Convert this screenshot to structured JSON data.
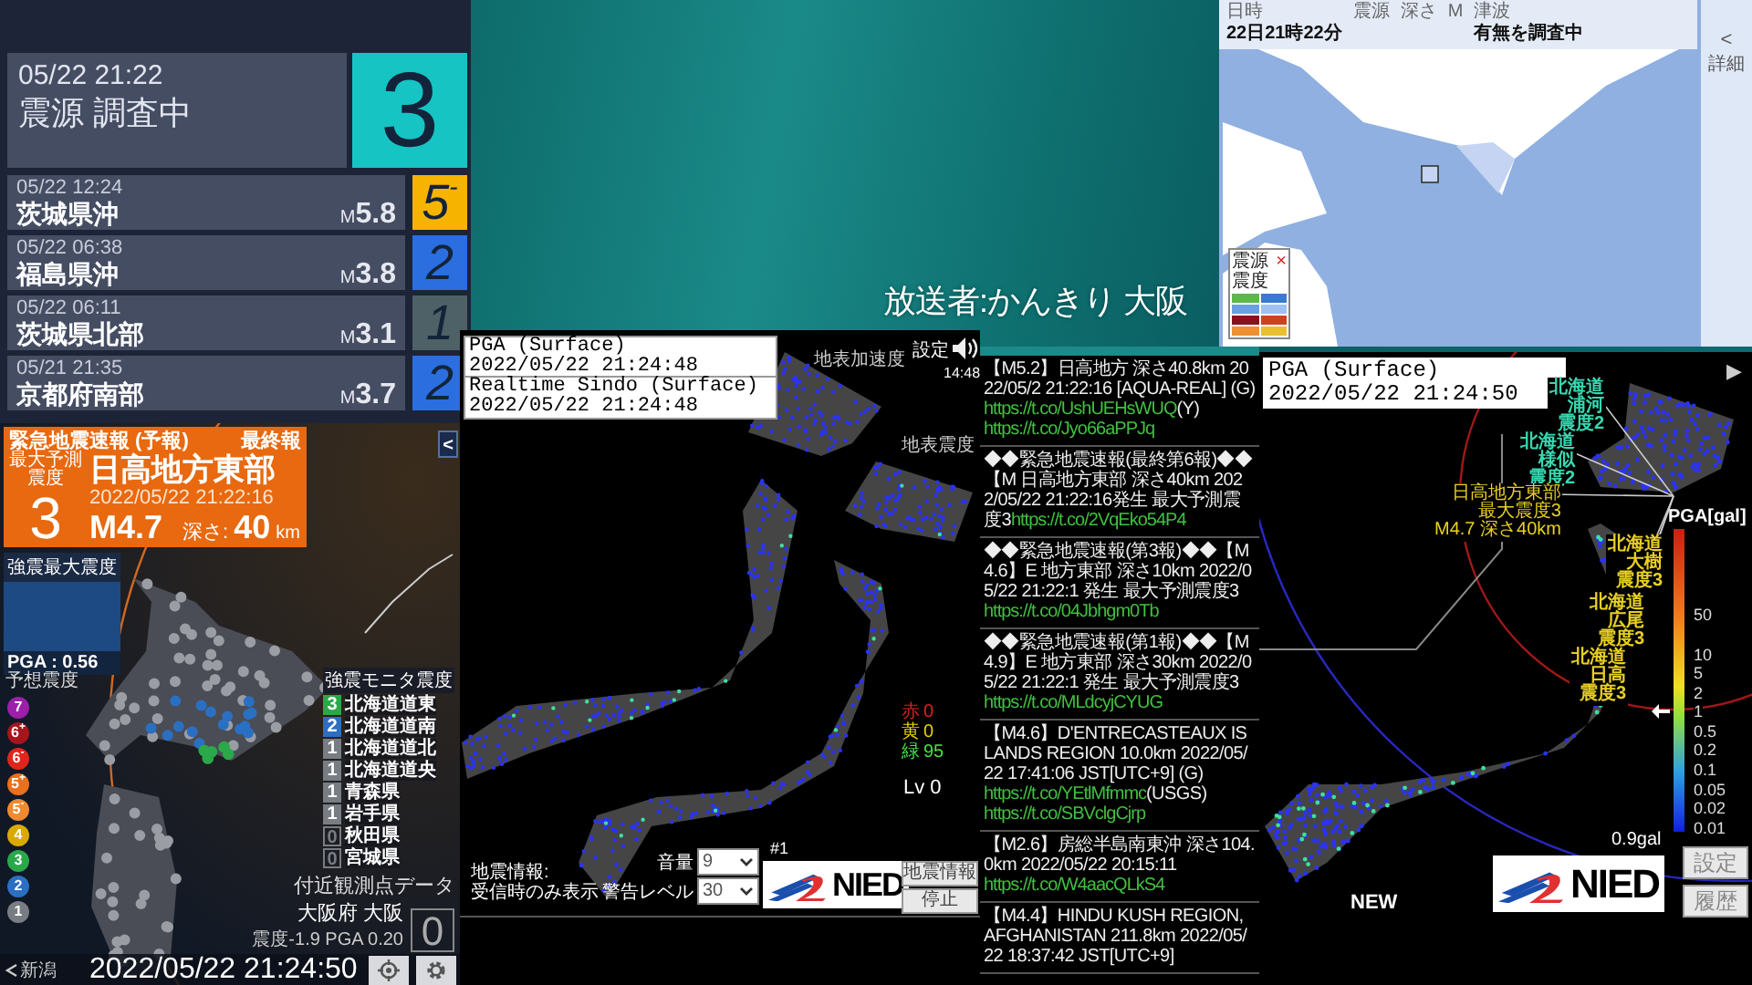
{
  "history": {
    "latest": {
      "time": "05/22  21:22",
      "place": "震源  調査中",
      "intensity": "3",
      "color": "#16c4c4"
    },
    "items": [
      {
        "time": "05/22 12:24",
        "place": "茨城県沖",
        "m_unit": "M",
        "magnitude": "5.8",
        "intensity": "5$^{-}$",
        "color": "#f6b400"
      },
      {
        "time": "05/22 06:38",
        "place": "福島県沖",
        "m_unit": "M",
        "magnitude": "3.8",
        "intensity": "2",
        "color": "#2a6ee0"
      },
      {
        "time": "05/22 06:11",
        "place": "茨城県北部",
        "m_unit": "M",
        "magnitude": "3.1",
        "intensity": "1",
        "color": "#4d6166"
      },
      {
        "time": "05/21 21:35",
        "place": "京都府南部",
        "m_unit": "M",
        "magnitude": "3.7",
        "intensity": "2",
        "color": "#2a6ee0"
      }
    ]
  },
  "eew": {
    "title": "緊急地震速報 (予報)",
    "report": "最終報",
    "max_label": "最大予測震度",
    "intensity": "3",
    "region": "日高地方東部",
    "time": "2022/05/22 21:22:16",
    "magnitude": "M4.7",
    "depth_label": "深さ:",
    "depth": "40",
    "depth_unit": "km",
    "collapse": "<",
    "strong_motion": {
      "label": "強震最大震度",
      "pga": "PGA : 0.56"
    },
    "forecast_legend": {
      "title": "予想震度",
      "levels": [
        {
          "label": "7",
          "color": "#9b1fa8"
        },
        {
          "label": "6$^{+}$",
          "color": "#a8141c"
        },
        {
          "label": "6$^{-}$",
          "color": "#e0261c"
        },
        {
          "label": "5$^{+}$",
          "color": "#e8701e"
        },
        {
          "label": "5$^{-}$",
          "color": "#f08a30"
        },
        {
          "label": "4",
          "color": "#d9aa00"
        },
        {
          "label": "3",
          "color": "#2aa84a"
        },
        {
          "label": "2",
          "color": "#2b6fc2"
        },
        {
          "label": "1",
          "color": "#787d84"
        }
      ]
    },
    "monitor": {
      "title": "強震モニタ震度",
      "stations": [
        {
          "intensity": "3",
          "name": "北海道道東",
          "kind": "filled",
          "color": "#2aa84a"
        },
        {
          "intensity": "2",
          "name": "北海道道南",
          "kind": "filled",
          "color": "#2b6fc2"
        },
        {
          "intensity": "1",
          "name": "北海道道北",
          "kind": "filled",
          "color": "#787d84"
        },
        {
          "intensity": "1",
          "name": "北海道道央",
          "kind": "filled",
          "color": "#787d84"
        },
        {
          "intensity": "1",
          "name": "青森県",
          "kind": "filled",
          "color": "#787d84"
        },
        {
          "intensity": "1",
          "name": "岩手県",
          "kind": "filled",
          "color": "#787d84"
        },
        {
          "intensity": "0",
          "name": "秋田県",
          "kind": "outline",
          "color": "#787d84"
        },
        {
          "intensity": "0",
          "name": "宮城県",
          "kind": "outline",
          "color": "#787d84"
        }
      ]
    },
    "nearby": {
      "title": "付近観測点データ",
      "station": "大阪府 大阪",
      "reading": "震度-1.9  PGA 0.20",
      "intensity": "0"
    },
    "footer": {
      "back": "新潟",
      "clock": "2022/05/22 21:24:50"
    }
  },
  "realtime": {
    "boxes": [
      {
        "title": "PGA (Surface)",
        "time": "2022/05/22 21:24:48"
      },
      {
        "title": "Realtime Sindo (Surface)",
        "time": "2022/05/22 21:24:48"
      }
    ],
    "map_labels": [
      "地表加速度",
      "地表震度"
    ],
    "settings": "設定",
    "clock": "14:48",
    "counts": [
      {
        "label": "赤",
        "value": "0",
        "color": "#e02020"
      },
      {
        "label": "黄",
        "value": "0",
        "color": "#e6d400"
      },
      {
        "label": "緑",
        "value": "95",
        "color": "#48e048"
      }
    ],
    "level": "Lv 0",
    "tag": "#1",
    "info_note": [
      "地震情報:",
      "受信時のみ表示"
    ],
    "volume": {
      "label": "音量",
      "value": "9"
    },
    "warning": {
      "label": "警告レベル",
      "value": "30"
    },
    "logo": "NIED",
    "buttons": [
      "地震情報",
      "停止"
    ]
  },
  "tweets": [
    {
      "segments": [
        {
          "text": "【M5.2】日高地方 深さ40.8km 2022/05/2 21:22:16 [AQUA-REAL] (G)",
          "link": false
        },
        {
          "text": "https://t.co/UshUEHsWUQ",
          "link": true
        },
        {
          "text": "(Y)",
          "link": false
        },
        {
          "text": "https://t.co/Jyo66aPPJq",
          "link": true
        }
      ]
    },
    {
      "segments": [
        {
          "text": "◆◆緊急地震速報(最終第6報)◆◆【M 日高地方東部 深さ40km 2022/05/22 21:22:16発生 最大予測震度3",
          "link": false
        },
        {
          "text": "https://t.co/2VqEko54P4",
          "link": true
        }
      ]
    },
    {
      "segments": [
        {
          "text": "◆◆緊急地震速報(第3報)◆◆【M4.6】E 地方東部 深さ10km 2022/05/22 21:22:1 発生 最大予測震度3",
          "link": false
        },
        {
          "text": "https://t.co/04Jbhgm0Tb",
          "link": true
        }
      ]
    },
    {
      "segments": [
        {
          "text": "◆◆緊急地震速報(第1報)◆◆【M4.9】E 地方東部 深さ30km 2022/05/22 21:22:1 発生 最大予測震度3",
          "link": false
        },
        {
          "text": "https://t.co/MLdcyjCYUG",
          "link": true
        }
      ]
    },
    {
      "segments": [
        {
          "text": "【M4.6】D'ENTRECASTEAUX ISLANDS REGION 10.0km 2022/05/22 17:41:06 JST[UTC+9] (G)",
          "link": false
        },
        {
          "text": "https://t.co/YEtlMfmmc",
          "link": true
        },
        {
          "text": "(USGS)",
          "link": false
        },
        {
          "text": "https://t.co/SBVclgCjrp",
          "link": true
        }
      ]
    },
    {
      "segments": [
        {
          "text": "【M2.6】房総半島南東沖 深さ104.0km 2022/05/22 20:15:11",
          "link": false
        },
        {
          "text": "https://t.co/W4aacQLkS4",
          "link": true
        }
      ]
    },
    {
      "segments": [
        {
          "text": "【M4.4】HINDU KUSH REGION, AFGHANISTAN 211.8km 2022/05/22 18:37:42 JST[UTC+9]",
          "link": false
        }
      ]
    }
  ],
  "jma_map": {
    "columns": [
      {
        "label": "日時",
        "value": "22日21時22分"
      },
      {
        "label": "震源"
      },
      {
        "label": "深さ"
      },
      {
        "label": "M"
      },
      {
        "label": "津波",
        "value": "有無を調査中"
      }
    ],
    "side": {
      "arrow": "<",
      "label": "詳細"
    },
    "legend": {
      "title": "震源",
      "close": "×",
      "scale_title": "震度",
      "swatches": [
        {
          "color": "#5db84a"
        },
        {
          "color": "#3a7ad0"
        },
        {
          "color": "#6aa0e0"
        },
        {
          "color": "#a0c0f0"
        },
        {
          "color": "#8a1020"
        },
        {
          "color": "#d04020"
        },
        {
          "color": "#f09030"
        },
        {
          "color": "#e8c030"
        }
      ]
    }
  },
  "broadcaster": "放送者:かんきり  大阪",
  "pga_map": {
    "box": {
      "title": "PGA (Surface)",
      "time": "2022/05/22 21:24:50"
    },
    "play": "▶",
    "callouts": [
      {
        "kind": "station",
        "lines": [
          "北海道",
          "浦河",
          "震度2"
        ],
        "color": "#38d8b0"
      },
      {
        "kind": "station",
        "lines": [
          "北海道",
          "様似",
          "震度2"
        ],
        "color": "#38d8b0"
      },
      {
        "kind": "epicenter",
        "lines": [
          "日高地方東部",
          "最大震度3",
          "M4.7 深さ40km"
        ],
        "color": "#e8d020"
      },
      {
        "kind": "station",
        "lines": [
          "北海道",
          "大樹",
          "震度3"
        ],
        "color": "#e8d020"
      },
      {
        "kind": "station",
        "lines": [
          "北海道",
          "広尾",
          "震度3"
        ],
        "color": "#e8d020"
      },
      {
        "kind": "station",
        "lines": [
          "北海道",
          "日高",
          "震度3"
        ],
        "color": "#e8d020"
      }
    ],
    "scale": {
      "title": "PGA[gal]",
      "ticks": [
        "50",
        "10",
        "5",
        "2",
        "1",
        "0.5",
        "0.2",
        "0.1",
        "0.05",
        "0.02",
        "0.01"
      ]
    },
    "reading": "0.9gal",
    "new_label": "NEW",
    "logo": "NIED",
    "buttons": [
      "設定",
      "履歴"
    ]
  }
}
